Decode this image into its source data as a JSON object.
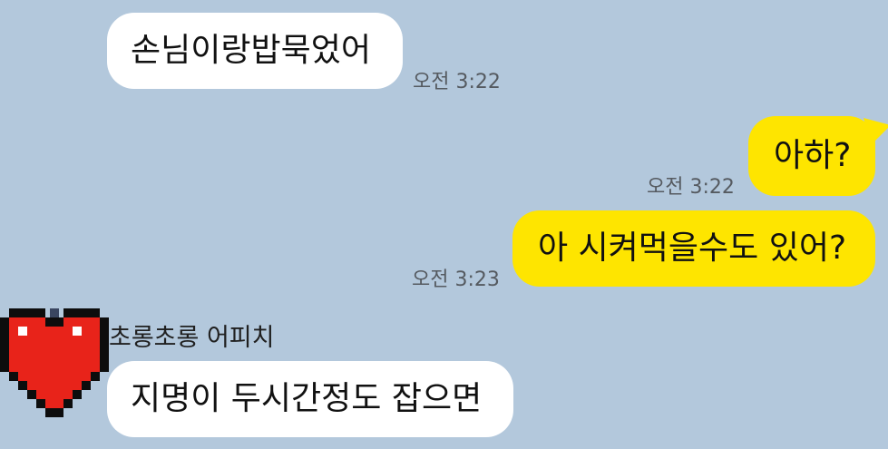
{
  "chat": {
    "messages": [
      {
        "direction": "incoming",
        "text": "손님이랑밥묵었어",
        "time": "오전 3:22"
      },
      {
        "direction": "outgoing",
        "text": "아하?",
        "time": "오전 3:22"
      },
      {
        "direction": "outgoing",
        "text": "아 시켜먹을수도 있어?",
        "time": "오전 3:23"
      },
      {
        "direction": "incoming",
        "sender": "초롱초롱 어피치",
        "avatar_icon": "pixel-heart-icon",
        "text": "지명이 두시간정도 잡으면"
      }
    ]
  },
  "colors": {
    "background": "#b3c8dc",
    "incoming_bubble": "#ffffff",
    "outgoing_bubble": "#fee500",
    "avatar_heart": "#e8231a"
  }
}
